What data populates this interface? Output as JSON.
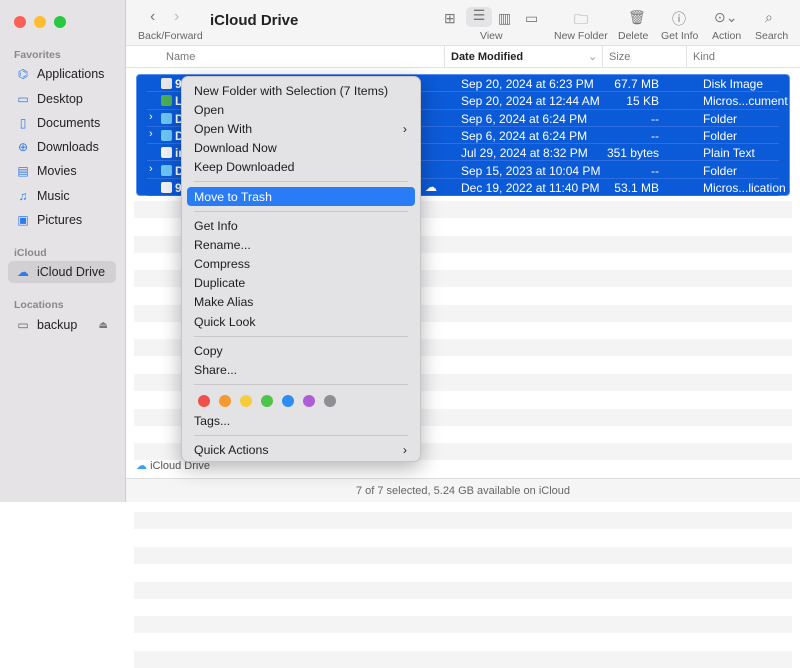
{
  "window": {
    "title": "iCloud Drive"
  },
  "sidebar": {
    "sections": [
      {
        "label": "Favorites",
        "items": [
          {
            "label": "Applications",
            "icon": "applications-icon"
          },
          {
            "label": "Desktop",
            "icon": "desktop-icon"
          },
          {
            "label": "Documents",
            "icon": "document-icon"
          },
          {
            "label": "Downloads",
            "icon": "download-icon"
          },
          {
            "label": "Movies",
            "icon": "film-icon"
          },
          {
            "label": "Music",
            "icon": "music-icon"
          },
          {
            "label": "Pictures",
            "icon": "photo-icon"
          }
        ]
      },
      {
        "label": "iCloud",
        "items": [
          {
            "label": "iCloud Drive",
            "icon": "cloud-icon"
          }
        ]
      },
      {
        "label": "Locations",
        "items": [
          {
            "label": "backup",
            "icon": "drive-icon"
          }
        ]
      }
    ]
  },
  "toolbar": {
    "back_forward": "Back/Forward",
    "view": "View",
    "new_folder": "New Folder",
    "delete": "Delete",
    "get_info": "Get Info",
    "action": "Action",
    "search": "Search"
  },
  "columns": {
    "name": "Name",
    "date": "Date Modified",
    "size": "Size",
    "kind": "Kind"
  },
  "files": [
    {
      "name": "91r",
      "date": "Sep 20, 2024 at 6:23 PM",
      "size": "67.7 MB",
      "kind": "Disk Image",
      "type": "disk",
      "color": "#e8e8e8"
    },
    {
      "name": "LU",
      "date": "Sep 20, 2024 at 12:44 AM",
      "size": "15 KB",
      "kind": "Micros...cument",
      "type": "doc",
      "color": "#4caf50"
    },
    {
      "name": "Do",
      "date": "Sep 6, 2024 at 6:24 PM",
      "size": "--",
      "kind": "Folder",
      "type": "folder",
      "color": "#6cc4f5"
    },
    {
      "name": "De",
      "date": "Sep 6, 2024 at 6:24 PM",
      "size": "--",
      "kind": "Folder",
      "type": "folder",
      "color": "#6cc4f5"
    },
    {
      "name": "info",
      "date": "Jul 29, 2024 at 8:32 PM",
      "size": "351 bytes",
      "kind": "Plain Text",
      "type": "text",
      "color": "#f2f2f2"
    },
    {
      "name": "Do",
      "date": "Sep 15, 2023 at 10:04 PM",
      "size": "--",
      "kind": "Folder",
      "type": "folder",
      "color": "#6cc4f5"
    },
    {
      "name": "91v",
      "date": "Dec 19, 2022 at 11:40 PM",
      "size": "53.1 MB",
      "kind": "Micros...lication",
      "type": "file",
      "color": "#f2f2f2"
    }
  ],
  "menu": {
    "groups": [
      [
        "New Folder with Selection (7 Items)",
        "Open",
        "Open With",
        "Download Now",
        "Keep Downloaded"
      ],
      [
        "Move to Trash"
      ],
      [
        "Get Info",
        "Rename...",
        "Compress",
        "Duplicate",
        "Make Alias",
        "Quick Look"
      ],
      [
        "Copy",
        "Share..."
      ]
    ],
    "tag_colors": [
      "#f0504a",
      "#f59a2e",
      "#f5cd3a",
      "#4cc54a",
      "#2f8cf5",
      "#ad5ed7",
      "#8e8e93"
    ],
    "tags": "Tags...",
    "quick_actions": "Quick Actions"
  },
  "path_bar": "iCloud Drive",
  "status": "7 of 7 selected, 5.24 GB available on iCloud"
}
